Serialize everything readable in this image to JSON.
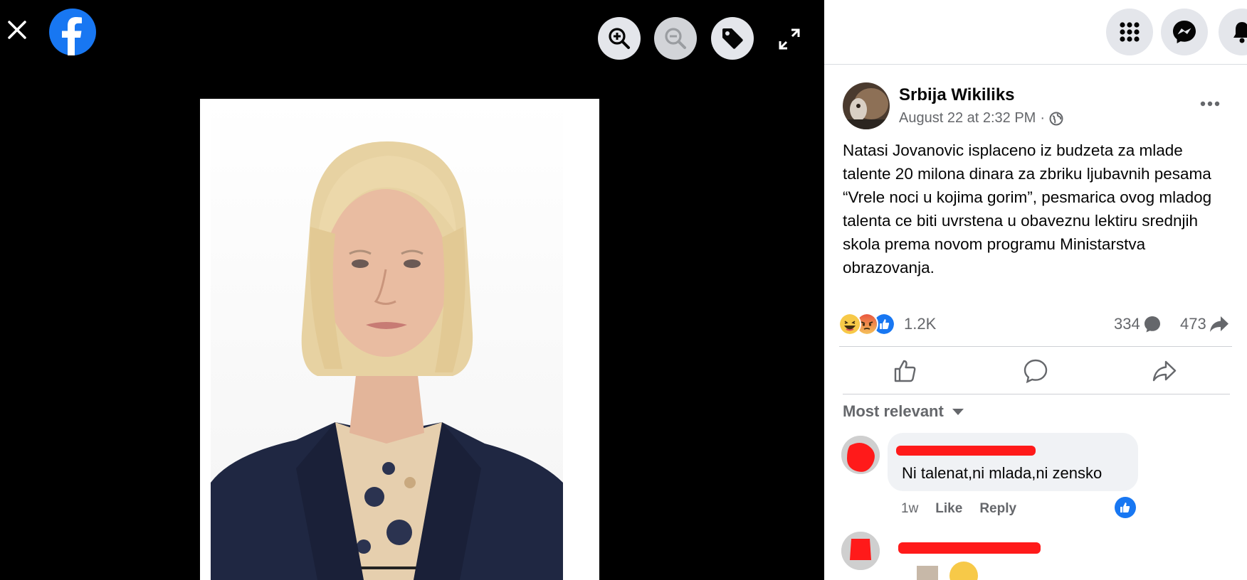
{
  "post": {
    "page_name": "Srbija Wikiliks",
    "timestamp": "August 22 at 2:32 PM",
    "separator": "·",
    "text": "Natasi Jovanovic isplaceno iz budzeta za mlade talente 20 milona dinara za zbriku ljubavnih pesama “Vrele noci u kojima gorim”, pesmarica ovog mladog talenta ce biti uvrstena u obaveznu lektiru srednjih skola prema novom programu Ministarstva obrazovanja.",
    "reaction_count": "1.2K",
    "comment_count": "334",
    "share_count": "473",
    "reactions": [
      "haha-icon",
      "angry-icon",
      "like-icon"
    ]
  },
  "comments": {
    "sort_label": "Most relevant",
    "items": [
      {
        "text": "Ni talenat,ni mlada,ni zensko",
        "time": "1w",
        "like_label": "Like",
        "reply_label": "Reply"
      }
    ]
  },
  "colors": {
    "facebook_blue": "#1877f2",
    "viewer_bg": "#000000",
    "redaction": "#ff1a1a"
  }
}
